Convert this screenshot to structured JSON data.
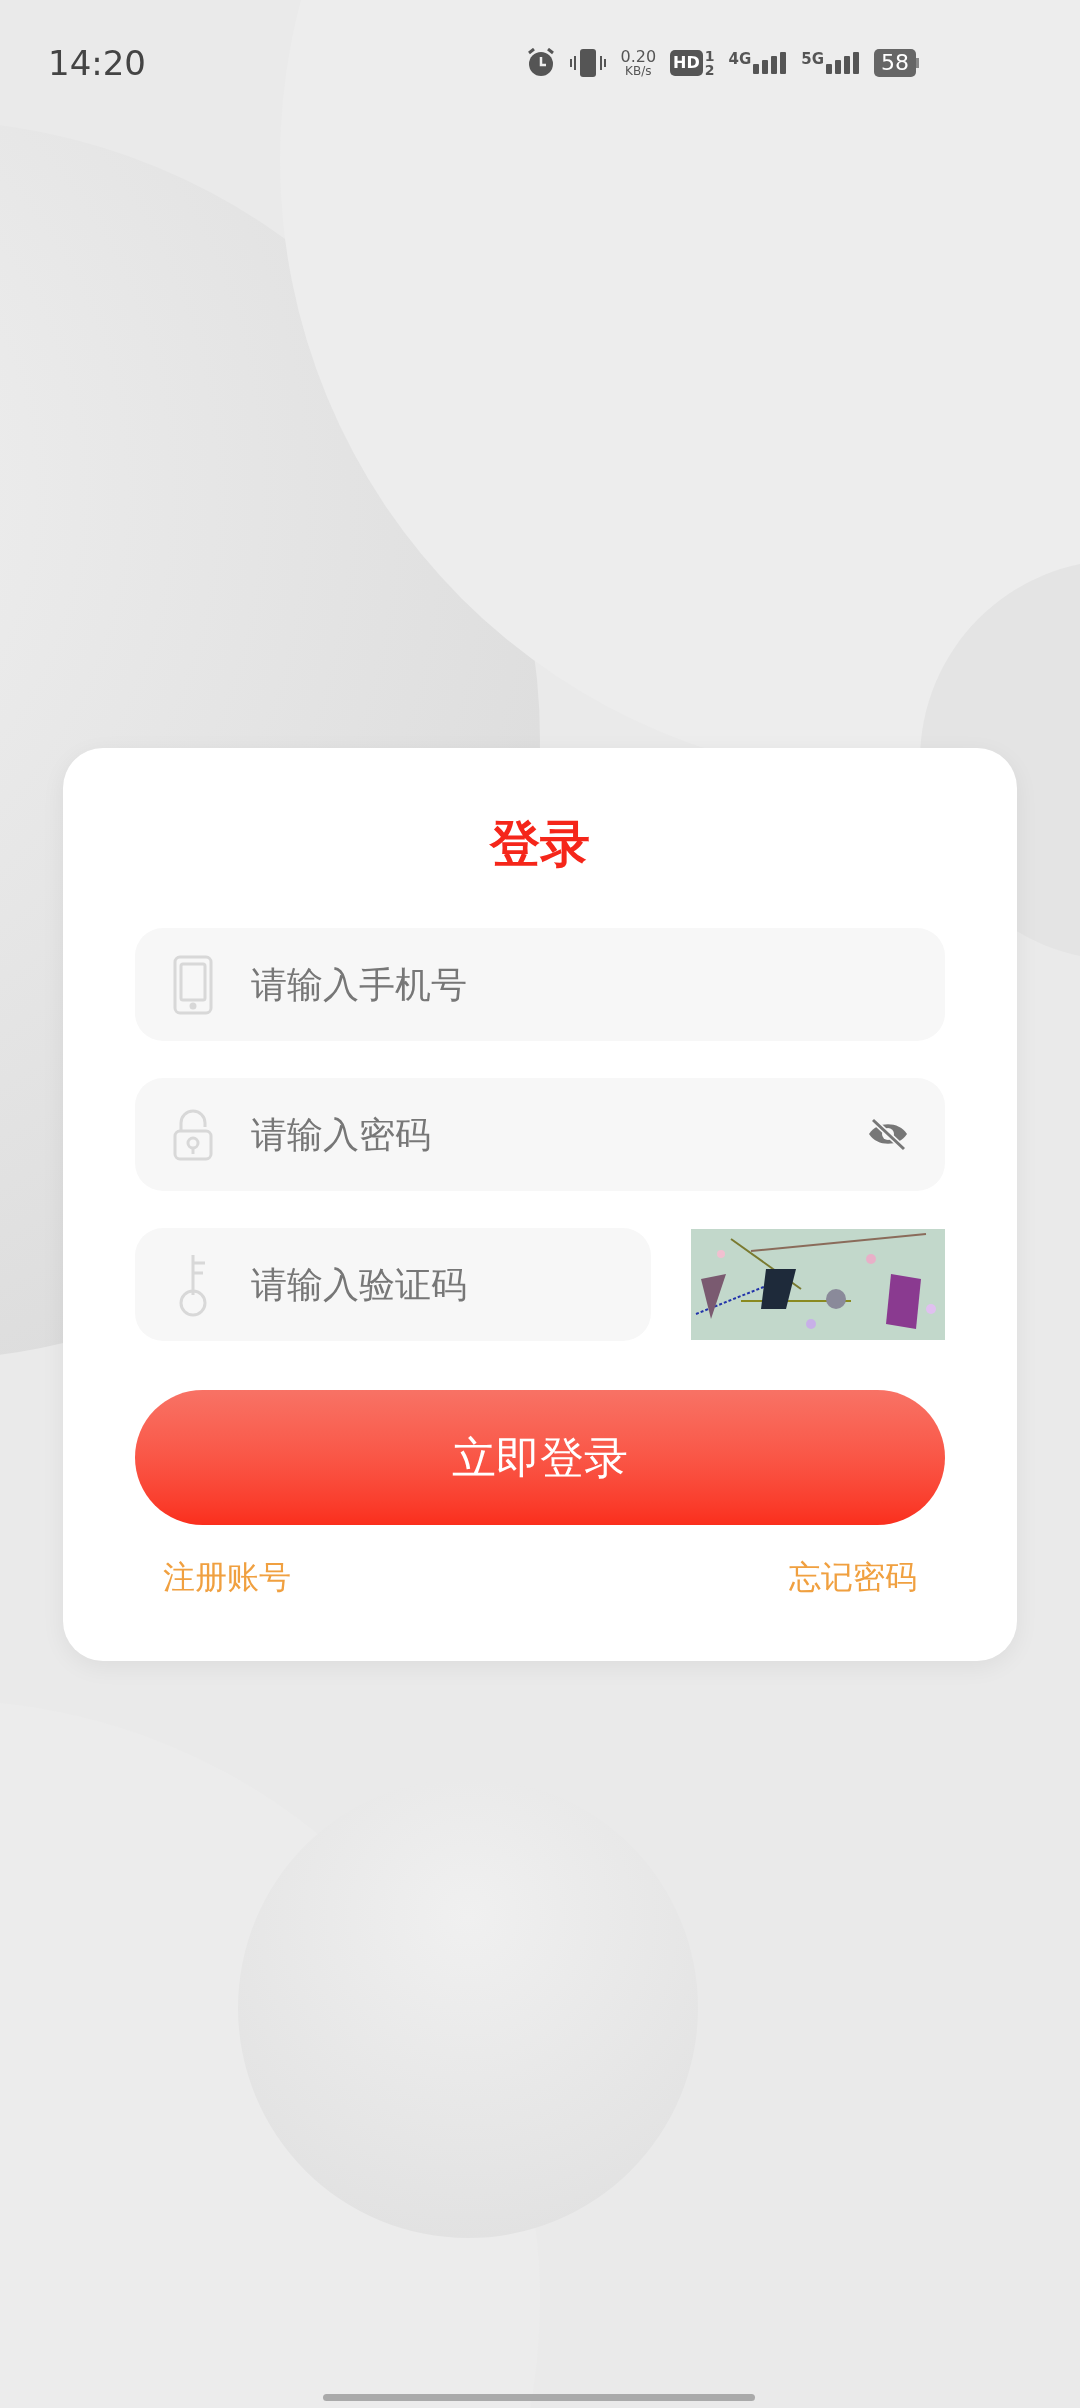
{
  "status_bar": {
    "time": "14:20",
    "net_speed": "0.20",
    "net_unit": "KB/s",
    "hd": "HD",
    "sims": [
      "1",
      "2"
    ],
    "networks": [
      "4G",
      "5G"
    ],
    "battery": "58"
  },
  "login_card": {
    "title": "登录",
    "fields": [
      {
        "kind": "phone",
        "placeholder": "请输入手机号"
      },
      {
        "kind": "password",
        "placeholder": "请输入密码"
      },
      {
        "kind": "captcha",
        "placeholder": "请输入验证码"
      }
    ],
    "captcha": {
      "kind": "picture"
    },
    "submit": "立即登录",
    "links": [
      "注册账号",
      "忘记密码"
    ]
  }
}
